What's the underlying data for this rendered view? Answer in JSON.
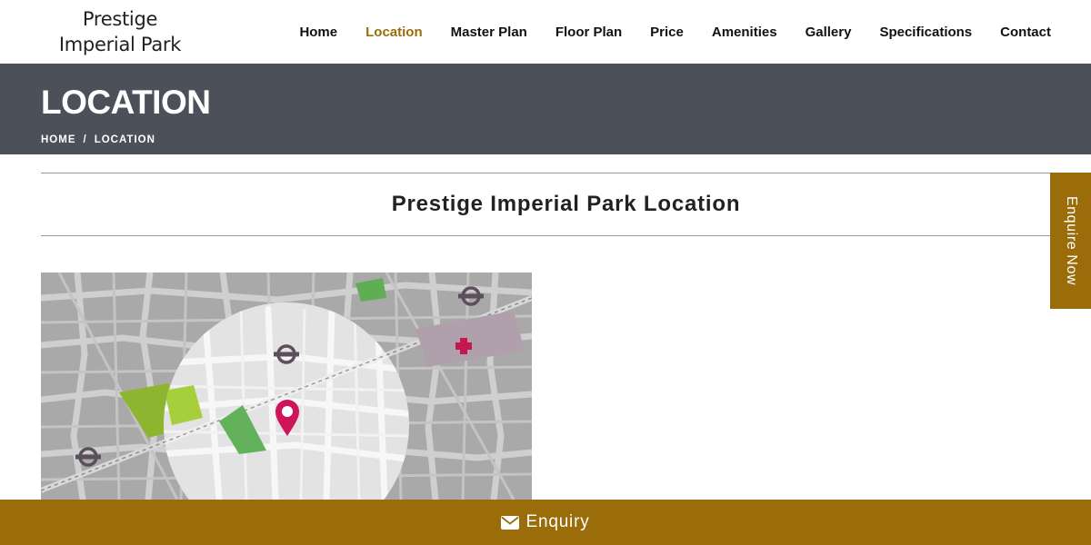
{
  "logo": {
    "line1": "Prestige",
    "line2": "Imperial Park"
  },
  "nav": {
    "items": [
      {
        "label": "Home",
        "active": false
      },
      {
        "label": "Location",
        "active": true
      },
      {
        "label": "Master Plan",
        "active": false
      },
      {
        "label": "Floor Plan",
        "active": false
      },
      {
        "label": "Price",
        "active": false
      },
      {
        "label": "Amenities",
        "active": false
      },
      {
        "label": "Gallery",
        "active": false
      },
      {
        "label": "Specifications",
        "active": false
      },
      {
        "label": "Contact",
        "active": false
      }
    ]
  },
  "banner": {
    "title": "LOCATION",
    "breadcrumb": [
      "HOME",
      "LOCATION"
    ],
    "separator": "/"
  },
  "section": {
    "title": "Prestige Imperial Park Location"
  },
  "map": {
    "icons": [
      "location-pin-icon",
      "metro-icon",
      "hospital-icon"
    ]
  },
  "side_tab": {
    "label": "Enquire Now"
  },
  "bottom_bar": {
    "label": "Enquiry",
    "icon": "envelope-icon"
  },
  "colors": {
    "accent": "#9a6c0a",
    "banner": "#4b5059",
    "pin": "#d0145a"
  }
}
